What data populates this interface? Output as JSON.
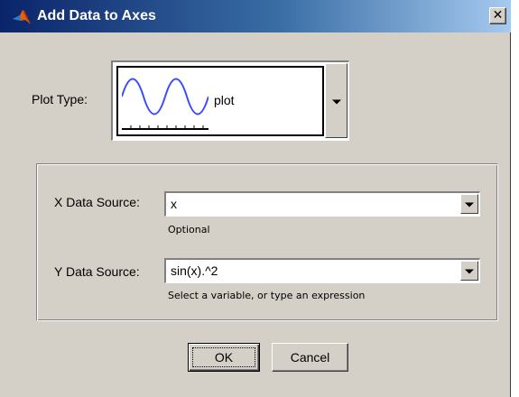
{
  "window": {
    "title": "Add Data to Axes",
    "close_glyph": "✕",
    "icon": "matlab-logo-icon"
  },
  "plot_type": {
    "label": "Plot Type:",
    "selected": "plot",
    "preview_icon": "sine-wave-plot-icon",
    "preview_color": "#3a4cff"
  },
  "x_source": {
    "label": "X Data Source:",
    "value": "x",
    "hint": "Optional"
  },
  "y_source": {
    "label": "Y Data Source:",
    "value": "sin(x).^2",
    "hint": "Select a variable, or type an expression"
  },
  "buttons": {
    "ok": "OK",
    "cancel": "Cancel"
  },
  "colors": {
    "dialog_bg": "#d4d0c8",
    "titlebar_start": "#0a246a",
    "titlebar_end": "#a6caf0"
  }
}
